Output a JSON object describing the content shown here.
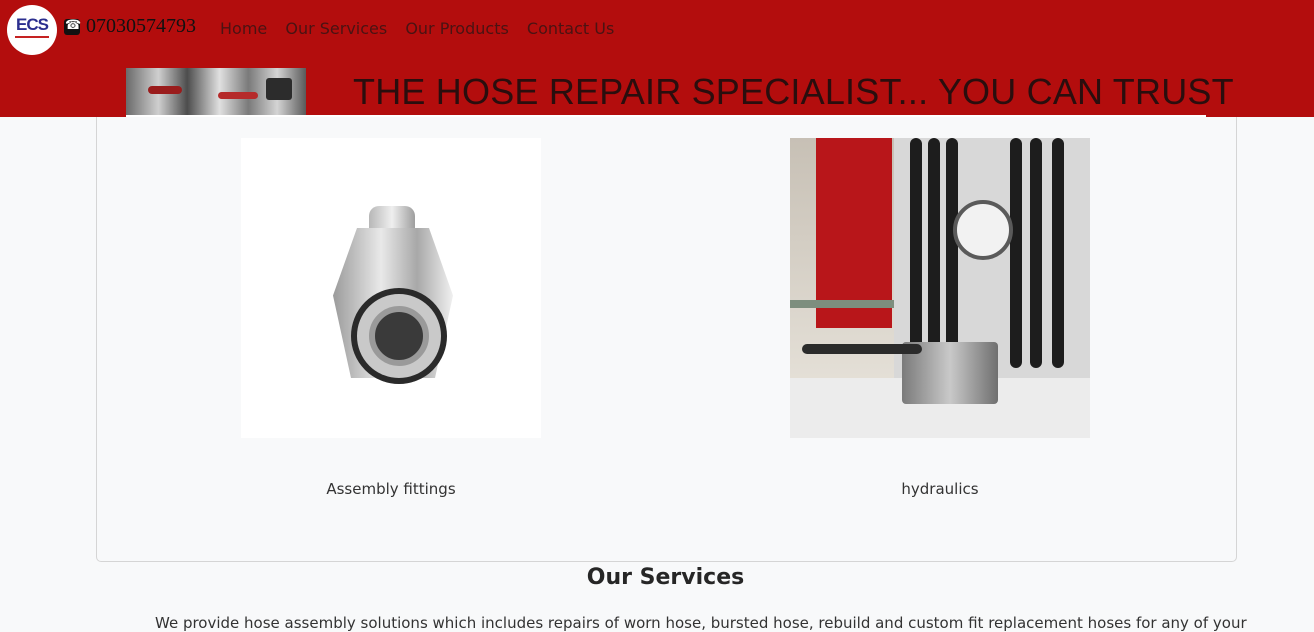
{
  "header": {
    "logo_text": "ECS",
    "phone": "07030574793",
    "nav": [
      "Home",
      "Our Services",
      "Our Products",
      "Contact Us"
    ],
    "tagline": "THE HOSE REPAIR SPECIALIST... YOU CAN TRUST"
  },
  "products": [
    {
      "caption": "Assembly fittings"
    },
    {
      "caption": "hydraulics"
    }
  ],
  "services": {
    "title": "Our Services",
    "text": "We provide hose assembly solutions which includes repairs of worn hose, bursted hose, rebuild and custom fit replacement hoses for any of your"
  },
  "colors": {
    "header_bg": "#b30d0d",
    "page_bg": "#f8f9fa"
  },
  "icons": {
    "phone": "phone-icon"
  }
}
